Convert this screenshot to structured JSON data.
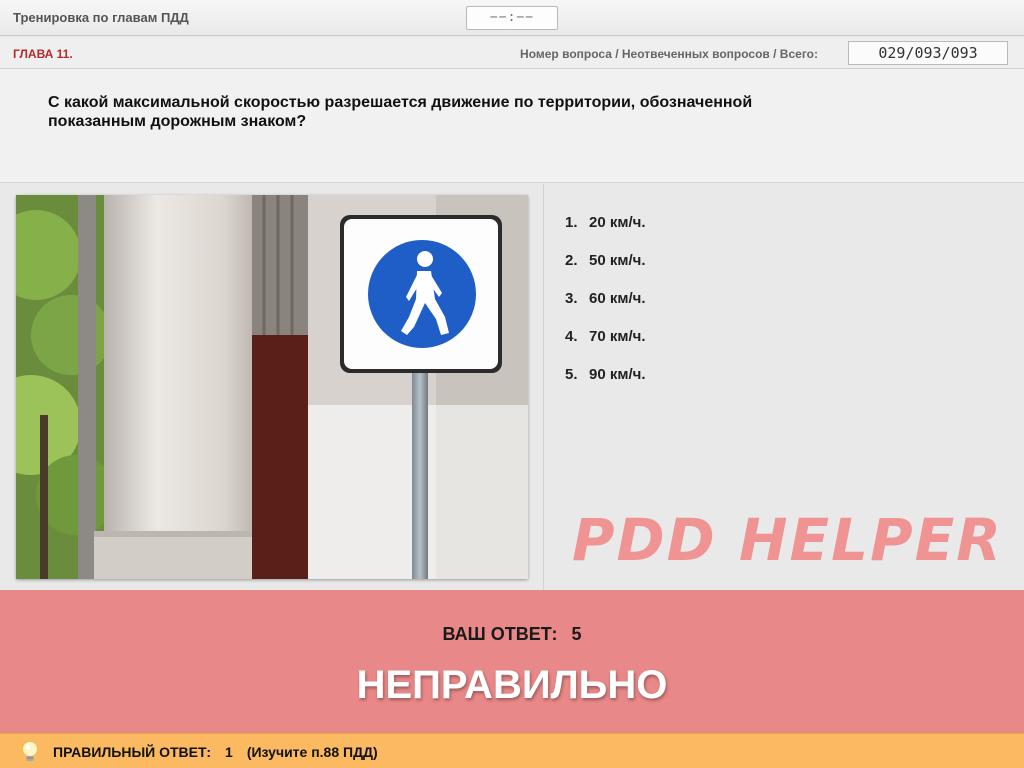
{
  "header": {
    "title": "Тренировка по главам ПДД",
    "timer": "−−:−−"
  },
  "chapter": {
    "label": "ГЛАВА 11.",
    "counter_label": "Номер вопроса / Неотвеченных вопросов / Всего:",
    "counter_value": "029/093/093"
  },
  "question": {
    "text": "С какой максимальной скоростью разрешается движение по территории, обозначенной показанным дорожным знаком?"
  },
  "answers": [
    {
      "num": "1.",
      "label": "20 км/ч."
    },
    {
      "num": "2.",
      "label": "50 км/ч."
    },
    {
      "num": "3.",
      "label": "60 км/ч."
    },
    {
      "num": "4.",
      "label": "70 км/ч."
    },
    {
      "num": "5.",
      "label": "90 км/ч."
    }
  ],
  "watermark": "PDD HELPER",
  "result": {
    "your_answer_label": "ВАШ  ОТВЕТ:",
    "your_answer_value": "5",
    "verdict": "НЕПРАВИЛЬНО"
  },
  "correct": {
    "label": "ПРАВИЛЬНЫЙ ОТВЕТ:",
    "value": "1",
    "hint": "(Изучите п.88 ПДД)"
  },
  "colors": {
    "chapter_red": "#b22a2a",
    "result_bg": "#e98888",
    "correct_bar_bg": "#fbb961",
    "sign_blue": "#1e5ec6"
  },
  "icons": {
    "sign": "pedestrian-zone-sign",
    "hint": "lightbulb-icon"
  }
}
